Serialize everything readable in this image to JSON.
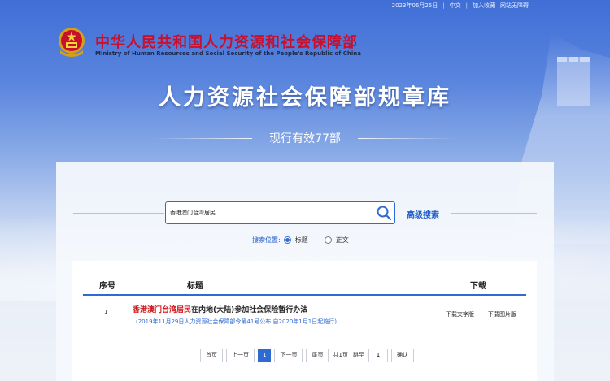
{
  "topbar": {
    "date": "2023年06月25日",
    "lang": "中文",
    "favorite": "加入收藏",
    "accessible": "网站无障碍"
  },
  "header": {
    "ministry_cn": "中华人民共和国人力资源和社会保障部",
    "ministry_en": "Ministry of Human Resources and Social Security of the People's Republic of China",
    "title": "人力资源社会保障部规章库",
    "subtitle": "现行有效77部"
  },
  "search": {
    "value": "香港澳门台湾居民",
    "advanced_label": "高级搜索",
    "scope_label": "搜索位置:",
    "options": [
      {
        "label": "标题",
        "checked": true
      },
      {
        "label": "正文",
        "checked": false
      }
    ]
  },
  "table": {
    "headers": {
      "no": "序号",
      "title": "标题",
      "download": "下载"
    },
    "rows": [
      {
        "no": "1",
        "title_highlight": "香港澳门台湾居民",
        "title_rest": "在内地(大陆)参加社会保险暂行办法",
        "note": "(2019年11月29日人力资源社会保障部令第41号公布 自2020年1月1日起施行)",
        "dl_text": "下载文字版",
        "dl_image": "下载图片版"
      }
    ]
  },
  "pager": {
    "first": "首页",
    "prev": "上一页",
    "current": "1",
    "next": "下一页",
    "last": "尾页",
    "total": "共1页",
    "goto": "跳至",
    "goto_value": "1",
    "confirm": "确认"
  },
  "colors": {
    "accent": "#2e6ad1",
    "highlight": "#d0141b",
    "ministry_red": "#c8102e"
  }
}
